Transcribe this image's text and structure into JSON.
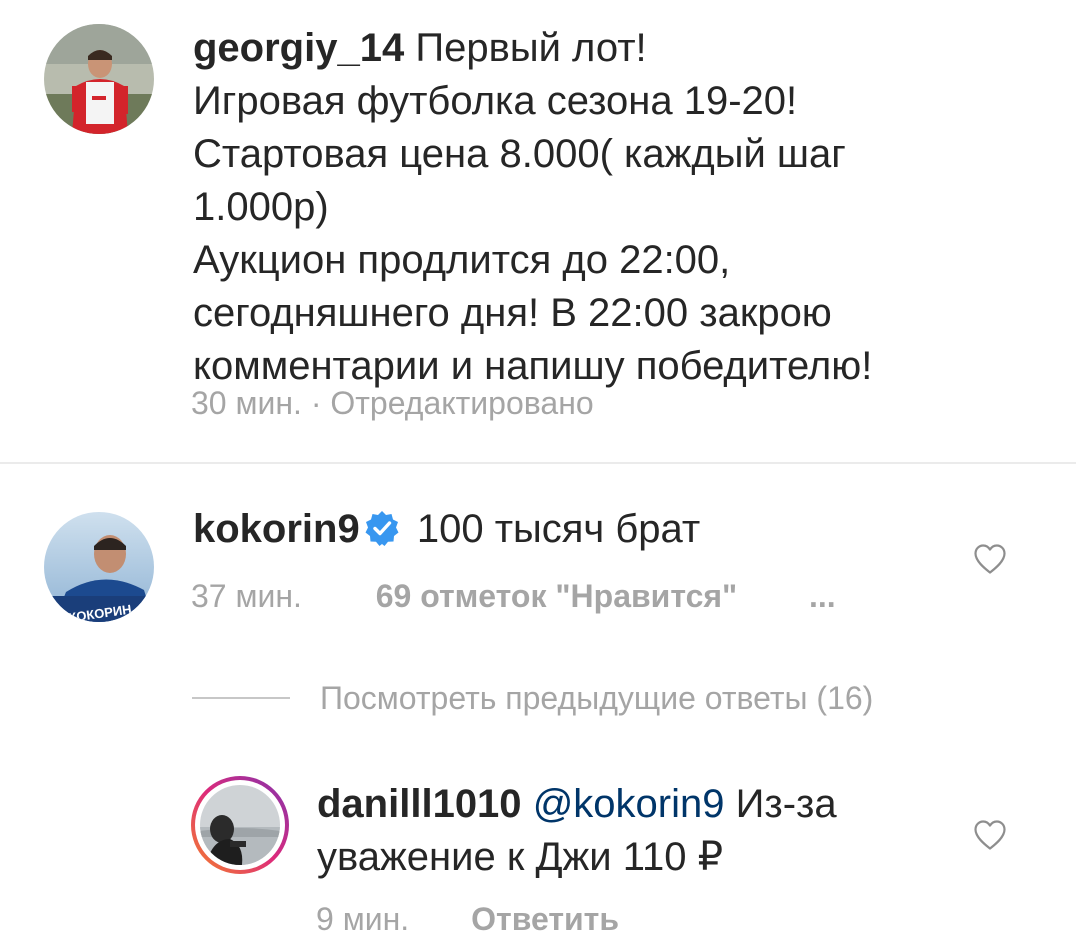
{
  "post": {
    "username": "georgiy_14",
    "caption_lines": [
      "Первый лот!",
      "Игровая футболка сезона 19-20!",
      "Стартовая цена 8.000( каждый шаг",
      "1.000р)",
      "Аукцион продлится до 22:00,",
      "сегодняшнего дня! В 22:00 закрою",
      "комментарии и напишу победителю!"
    ],
    "time": "30 мин.",
    "separator": "·",
    "edited": "Отредактировано"
  },
  "comment": {
    "username": "kokorin9",
    "verified": true,
    "text": "100 тысяч брат",
    "time": "37 мин.",
    "likes": "69 отметок \"Нравится\"",
    "more": "...",
    "avatar_caption": "КОКОРИН",
    "view_previous": "Посмотреть предыдущие ответы (16)"
  },
  "reply": {
    "username": "danilll1010",
    "mention": "@kokorin9",
    "text_line1": "Из-за",
    "text_line2": "уважение к Джи 110 ₽",
    "time": "9 мин.",
    "reply_label": "Ответить"
  },
  "icons": {
    "like": "heart-outline-icon",
    "verified": "verified-badge-icon",
    "more": "more-options-icon"
  },
  "colors": {
    "text": "#262626",
    "meta": "#a5a5a5",
    "verified": "#3897f0",
    "mention": "#003569",
    "story_ring_start": "#f58529",
    "story_ring_end": "#dd2a7b"
  }
}
